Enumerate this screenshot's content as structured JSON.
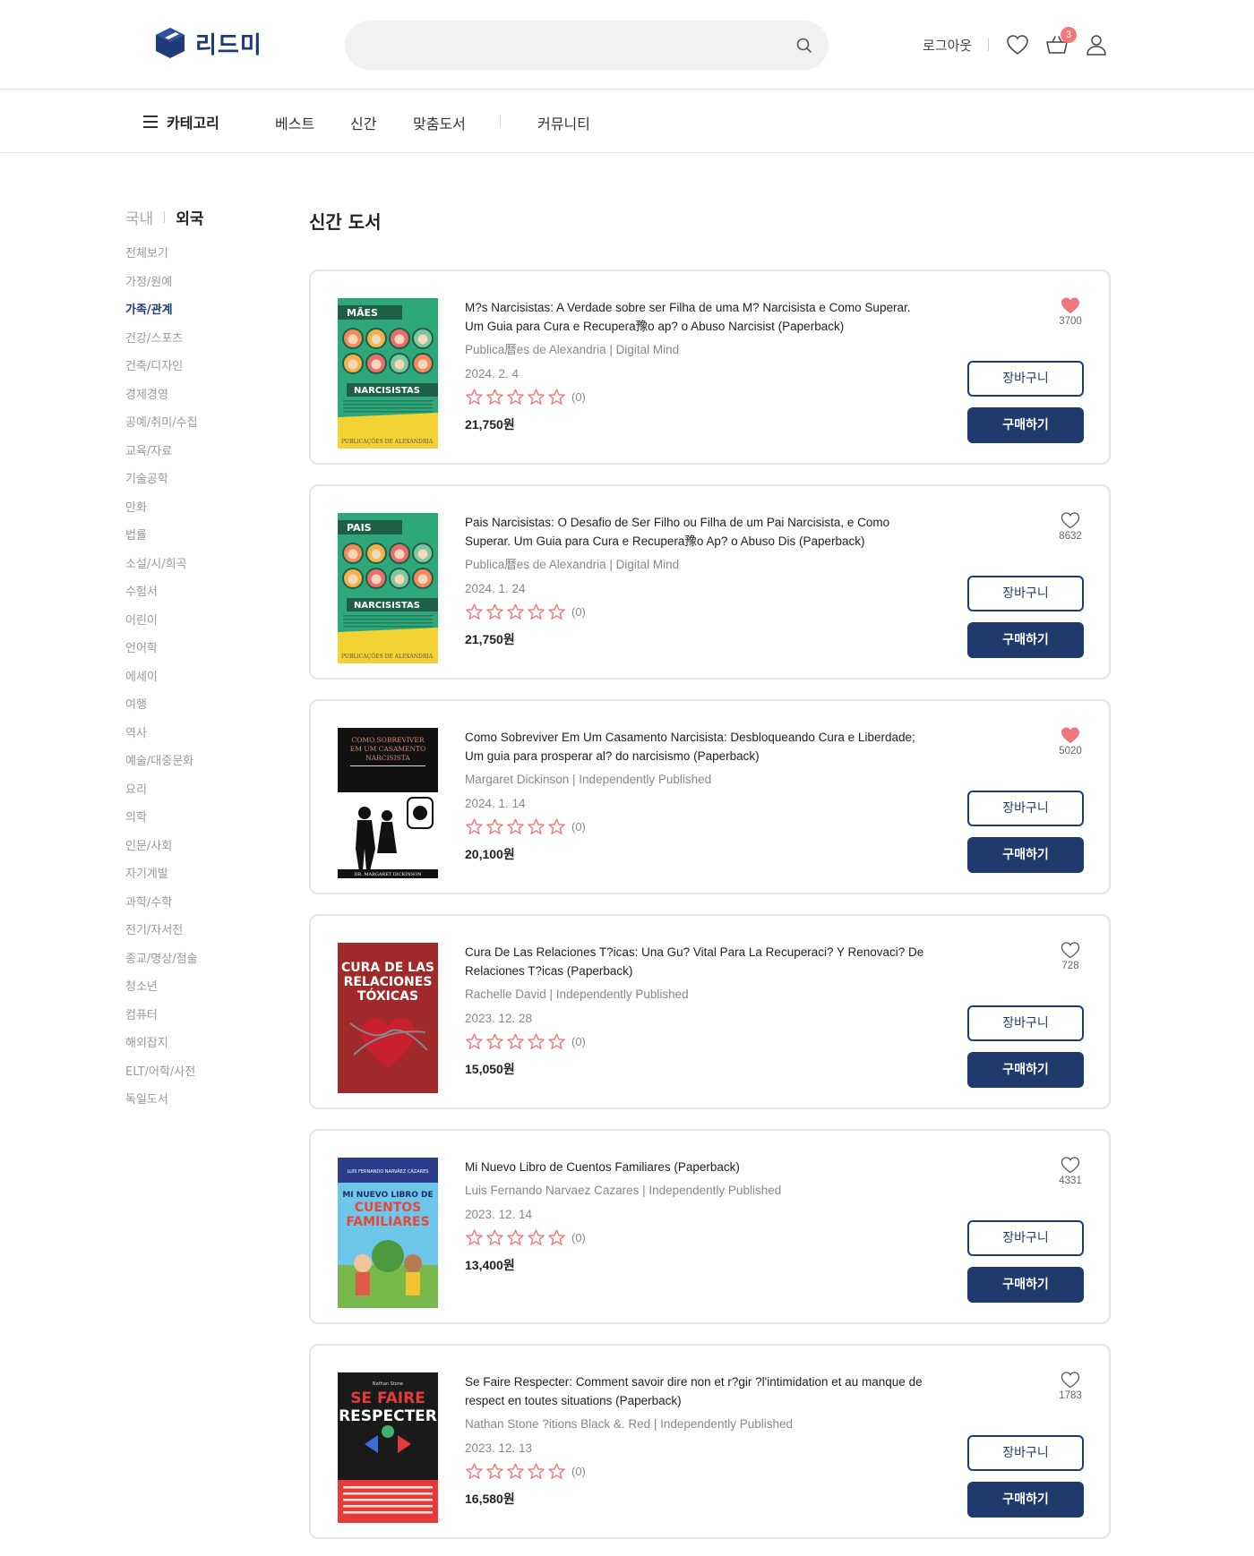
{
  "header": {
    "logo_text": "리드미",
    "search_placeholder": "",
    "logout_label": "로그아웃",
    "cart_count": "3",
    "icons": [
      "search-icon",
      "heart-icon",
      "cart-icon",
      "user-icon"
    ]
  },
  "nav": {
    "category_label": "카테고리",
    "items": [
      "베스트",
      "신간",
      "맞춤도서",
      "커뮤니티"
    ]
  },
  "sidebar": {
    "tabs": [
      "국내",
      "외국"
    ],
    "active_tab": "외국",
    "categories": [
      "전체보기",
      "가정/원예",
      "가족/관계",
      "건강/스포츠",
      "건축/디자인",
      "경제경영",
      "공예/취미/수집",
      "교육/자료",
      "기술공학",
      "만화",
      "법률",
      "소설/시/희곡",
      "수험서",
      "어린이",
      "언어학",
      "에세이",
      "여행",
      "역사",
      "예술/대중문화",
      "요리",
      "의학",
      "인문/사회",
      "자기계발",
      "과학/수학",
      "전기/자서전",
      "종교/명상/점술",
      "청소년",
      "컴퓨터",
      "해외잡지",
      "ELT/어학/사전",
      "독일도서"
    ],
    "current": "가족/관계"
  },
  "main": {
    "title": "신간 도서",
    "cart_button_label": "장바구니",
    "buy_button_label": "구매하기",
    "books": [
      {
        "title": "M?s Narcisistas: A Verdade sobre ser Filha de uma M? Narcisista e Como Superar. Um Guia para Cura e Recupera豫o ap? o Abuso Narcisist (Paperback)",
        "author_publisher": "Publica曆es de Alexandria | Digital Mind",
        "date": "2024. 2. 4",
        "rating_count": "(0)",
        "price": "21,750원",
        "liked": true,
        "likes": "3700",
        "cover": {
          "top_word": "MÃES",
          "main_word": "NARCISISTAS",
          "footer": "PUBLICAÇÕES DE ALEXANDRIA",
          "bg": "#2ea87a",
          "style": "faces"
        }
      },
      {
        "title": "Pais Narcisistas: O Desafio de Ser Filho ou Filha de um Pai Narcisista, e Como Superar. Um Guia para Cura e Recupera豫o Ap? o Abuso Dis (Paperback)",
        "author_publisher": "Publica曆es de Alexandria | Digital Mind",
        "date": "2024. 1. 24",
        "rating_count": "(0)",
        "price": "21,750원",
        "liked": false,
        "likes": "8632",
        "cover": {
          "top_word": "PAIS",
          "main_word": "NARCISISTAS",
          "footer": "PUBLICAÇÕES DE ALEXANDRIA",
          "bg": "#2ea87a",
          "style": "faces"
        }
      },
      {
        "title": "Como Sobreviver Em Um Casamento Narcisista: Desbloqueando Cura e Liberdade; Um guia para prosperar al? do narcisismo (Paperback)",
        "author_publisher": "Margaret Dickinson | Independently Published",
        "date": "2024. 1. 14",
        "rating_count": "(0)",
        "price": "20,100원",
        "liked": true,
        "likes": "5020",
        "cover": {
          "top_word": "COMO SOBREVIVER EM UM CASAMENTO NARCISISTA",
          "main_word": "",
          "footer": "DR. MARGARET DICKINSON",
          "bg": "#111111",
          "style": "silhouette"
        }
      },
      {
        "title": "Cura De Las Relaciones T?icas: Una Gu? Vital Para La Recuperaci? Y Renovaci? De Relaciones T?icas (Paperback)",
        "author_publisher": "Rachelle David | Independently Published",
        "date": "2023. 12. 28",
        "rating_count": "(0)",
        "price": "15,050원",
        "liked": false,
        "likes": "728",
        "cover": {
          "top_word": "CURA DE LAS RELACIONES TÓXICAS",
          "main_word": "",
          "footer": "",
          "bg": "#a02a2a",
          "style": "heart"
        }
      },
      {
        "title": "Mi Nuevo Libro de Cuentos Familiares (Paperback)",
        "author_publisher": "Luis Fernando Narvaez Cazares | Independently Published",
        "date": "2023. 12. 14",
        "rating_count": "(0)",
        "price": "13,400원",
        "liked": false,
        "likes": "4331",
        "cover": {
          "top_word": "MI NUEVO LIBRO DE",
          "main_word": "CUENTOS FAMILIARES",
          "footer": "LUIS FERNANDO NARVÁEZ CÁZARES",
          "bg": "#6ec6e8",
          "style": "kids"
        }
      },
      {
        "title": "Se Faire Respecter: Comment savoir dire non et r?gir ?l'intimidation et au manque de respect en toutes situations (Paperback)",
        "author_publisher": "Nathan Stone ?itions Black &. Red | Independently Published",
        "date": "2023. 12. 13",
        "rating_count": "(0)",
        "price": "16,580원",
        "liked": false,
        "likes": "1783",
        "cover": {
          "top_word": "SE FAIRE",
          "main_word": "RESPECTER",
          "footer": "",
          "bg": "#1a1a1a",
          "style": "respect"
        }
      }
    ]
  },
  "colors": {
    "brand": "#1e3a78",
    "button": "#1f3b6e",
    "heart": "#f0787a",
    "star": "#f0787a"
  }
}
